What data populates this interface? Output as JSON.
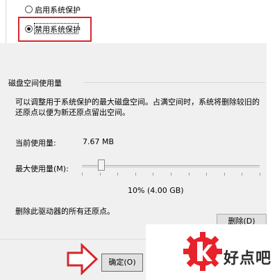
{
  "protection": {
    "enable_label": "启用系统保护",
    "disable_label": "禁用系统保护",
    "selected": "disable"
  },
  "disk_usage": {
    "section_title": "磁盘空间使用量",
    "description": "可以调整用于系统保护的最大磁盘空间。占满空间时，系统将删除较旧的还原点以便为新还原点留出空间。",
    "current_usage_label": "当前使用量:",
    "current_usage_value": "7.67 MB",
    "max_usage_label": "最大使用量(M):",
    "max_usage_percent": 10,
    "max_usage_display": "10% (4.00 GB)"
  },
  "restore_points": {
    "delete_text": "删除此驱动器的所有还原点。",
    "delete_button": "删除(D)"
  },
  "footer": {
    "ok_button": "确定(O)"
  },
  "watermark": {
    "text": "好点吧"
  },
  "colors": {
    "highlight": "#d6262b",
    "arrow": "#d6262b",
    "logo": "#e8222a"
  }
}
